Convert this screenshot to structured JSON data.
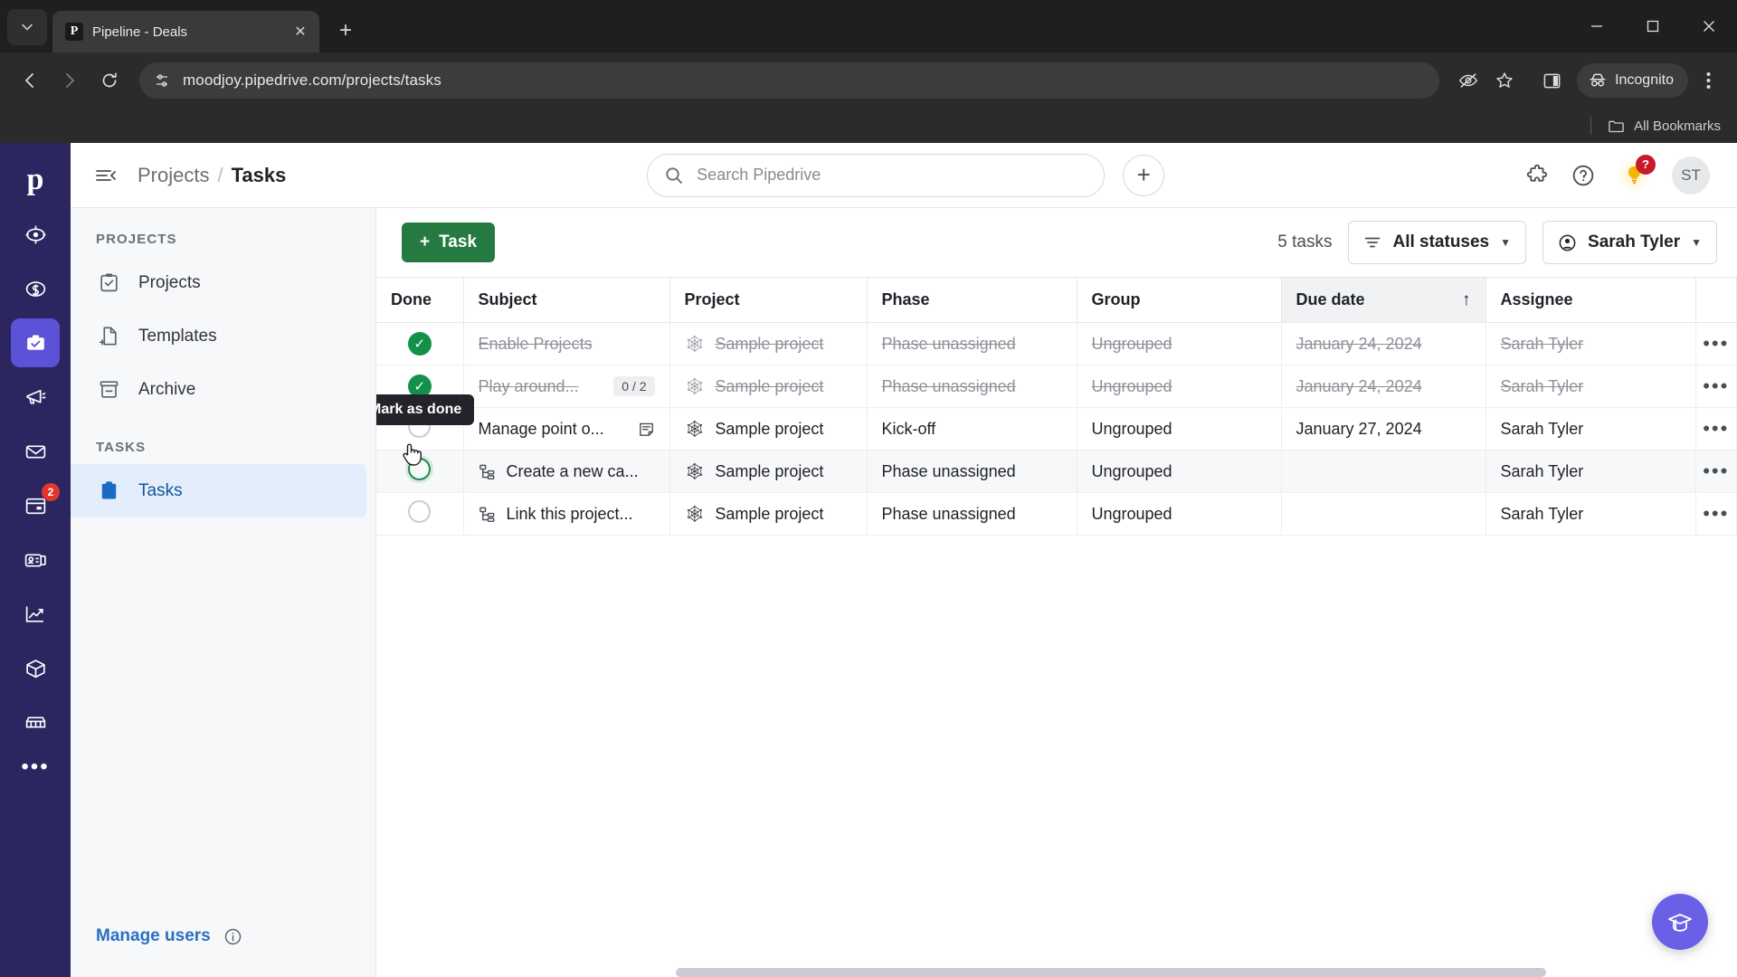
{
  "browser": {
    "tab": {
      "title": "Pipeline - Deals",
      "favicon_letter": "P"
    },
    "new_tab_label": "+",
    "url": "moodjoy.pipedrive.com/projects/tasks",
    "incognito_label": "Incognito",
    "bookmarks_label": "All Bookmarks",
    "window_controls": {
      "minimize": "—",
      "maximize": "□",
      "close": "✕"
    }
  },
  "rail": {
    "logo": "p",
    "items": [
      {
        "name": "leads",
        "badge": ""
      },
      {
        "name": "deals",
        "badge": ""
      },
      {
        "name": "projects",
        "badge": "",
        "active": true
      },
      {
        "name": "campaigns",
        "badge": ""
      },
      {
        "name": "mail",
        "badge": ""
      },
      {
        "name": "activities",
        "badge": "2"
      },
      {
        "name": "contacts",
        "badge": ""
      },
      {
        "name": "insights",
        "badge": ""
      },
      {
        "name": "products",
        "badge": ""
      },
      {
        "name": "marketplace",
        "badge": ""
      }
    ],
    "more": "•••"
  },
  "header": {
    "breadcrumb_parent": "Projects",
    "breadcrumb_sep": "/",
    "breadcrumb_current": "Tasks",
    "search_placeholder": "Search Pipedrive",
    "add_button": "+",
    "help_badge": "?",
    "avatar_initials": "ST"
  },
  "sidebar": {
    "section_projects": "PROJECTS",
    "section_tasks": "TASKS",
    "items": [
      {
        "label": "Projects",
        "icon": "clipboard-check-icon"
      },
      {
        "label": "Templates",
        "icon": "file-plus-icon"
      },
      {
        "label": "Archive",
        "icon": "archive-icon"
      }
    ],
    "task_items": [
      {
        "label": "Tasks",
        "icon": "clipboard-filled-icon",
        "active": true
      }
    ],
    "footer_link": "Manage users"
  },
  "toolbar": {
    "add_task_label": "Task",
    "add_task_plus": "+",
    "count_label": "5 tasks",
    "status_filter": "All statuses",
    "assignee_filter": "Sarah Tyler"
  },
  "table": {
    "columns": [
      "Done",
      "Subject",
      "Project",
      "Phase",
      "Group",
      "Due date",
      "Assignee"
    ],
    "sorted_column": "Due date",
    "sort_direction": "↑",
    "rows": [
      {
        "done": true,
        "subject": "Enable Projects",
        "subject_badge": "",
        "subject_icon": "",
        "project": "Sample project",
        "phase": "Phase unassigned",
        "group": "Ungrouped",
        "due_date": "January 24, 2024",
        "assignee": "Sarah Tyler",
        "menu": "•••"
      },
      {
        "done": true,
        "subject": "Play around...",
        "subject_badge": "0 / 2",
        "subject_icon": "",
        "project": "Sample project",
        "phase": "Phase unassigned",
        "group": "Ungrouped",
        "due_date": "January 24, 2024",
        "assignee": "Sarah Tyler",
        "menu": "•••"
      },
      {
        "done": false,
        "subject": "Manage point o...",
        "subject_badge": "",
        "subject_icon": "note-icon",
        "project": "Sample project",
        "phase": "Kick-off",
        "group": "Ungrouped",
        "due_date": "January 27, 2024",
        "assignee": "Sarah Tyler",
        "menu": "•••"
      },
      {
        "done": false,
        "subject": "Create a new ca...",
        "subject_badge": "",
        "subject_icon": "subtask-icon",
        "project": "Sample project",
        "phase": "Phase unassigned",
        "group": "Ungrouped",
        "due_date": "",
        "assignee": "Sarah Tyler",
        "menu": "•••",
        "hover": true
      },
      {
        "done": false,
        "subject": "Link this project...",
        "subject_badge": "",
        "subject_icon": "subtask-icon",
        "project": "Sample project",
        "phase": "Phase unassigned",
        "group": "Ungrouped",
        "due_date": "",
        "assignee": "Sarah Tyler",
        "menu": "•••"
      }
    ]
  },
  "tooltip": {
    "text": "Mark as done"
  },
  "fab": {
    "icon": "graduation-cap-icon"
  },
  "colors": {
    "accent_green": "#257a41",
    "done_green": "#13914a",
    "rail_purple": "#2b2560",
    "rail_active": "#5b52d8",
    "sidebar_active_bg": "#e3edfb",
    "sidebar_active_text": "#14559c",
    "fab_purple": "#6a60e8",
    "badge_red": "#e4342f"
  }
}
